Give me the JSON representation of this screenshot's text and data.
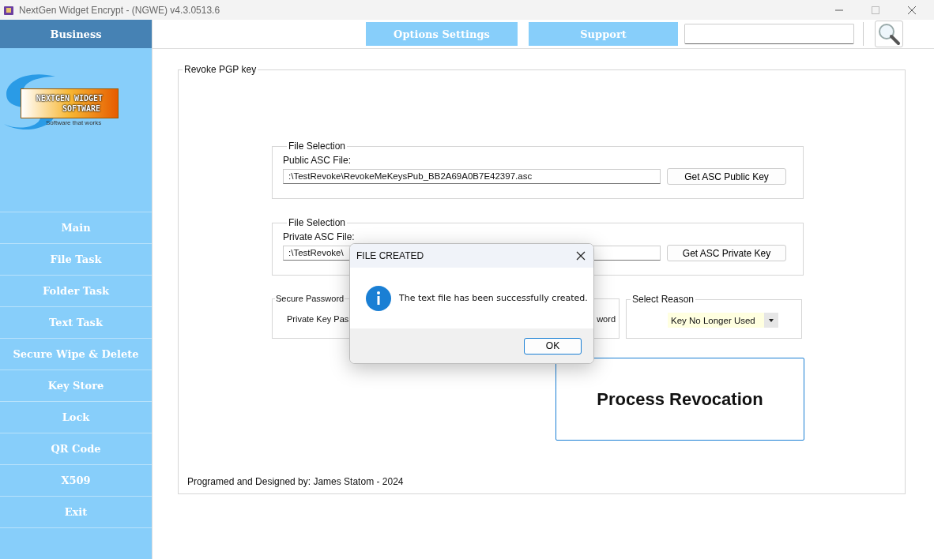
{
  "window": {
    "title": "NextGen Widget Encrypt - (NGWE) v4.3.0513.6"
  },
  "sidebar": {
    "header": "Business",
    "logo": {
      "line_1": "NEXTGEN WIDGET",
      "line_2": "SOFTWARE",
      "tagline": "Software that works"
    },
    "items": [
      {
        "label": "Main"
      },
      {
        "label": "File Task"
      },
      {
        "label": "Folder Task"
      },
      {
        "label": "Text Task"
      },
      {
        "label": "Secure Wipe & Delete"
      },
      {
        "label": "Key Store"
      },
      {
        "label": "Lock"
      },
      {
        "label": "QR Code"
      },
      {
        "label": "X509"
      },
      {
        "label": "Exit"
      }
    ]
  },
  "toolbar": {
    "buttons": [
      "Options Settings",
      "Support"
    ]
  },
  "panel": {
    "title": "Revoke PGP key",
    "public_file": {
      "group": "File Selection",
      "label": "Public ASC File:",
      "value": ":\\TestRevoke\\RevokeMeKeysPub_BB2A69A0B7E42397.asc",
      "button": "Get ASC Public Key"
    },
    "private_file": {
      "group": "File Selection",
      "label": "Private ASC File:",
      "value": ":\\TestRevoke\\",
      "button": "Get ASC Private Key"
    },
    "password": {
      "group": "Secure Password",
      "label": "Private Key Pas",
      "label_2": "word"
    },
    "reason": {
      "group": "Select Reason",
      "value": "Key No Longer Used"
    },
    "process_button": "Process Revocation",
    "footer": "Programed and Designed by: James Statom - 2024"
  },
  "dialog": {
    "title": "FILE CREATED",
    "message": "The text file has been successfully created.",
    "button": "OK"
  }
}
